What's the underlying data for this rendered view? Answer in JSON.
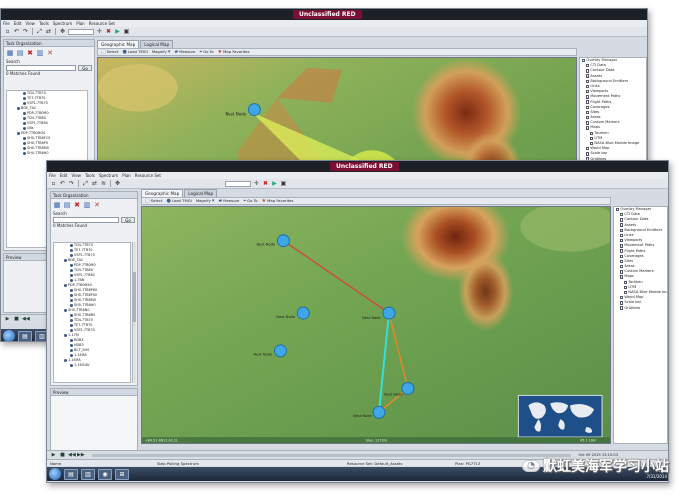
{
  "classification_label": "Unclassified RED",
  "menu": [
    "File",
    "Edit",
    "View",
    "Tools",
    "Spectrum",
    "Plan",
    "Resource Set"
  ],
  "org_panel": {
    "title": "Task Organization",
    "search_label": "Search",
    "go_label": "Go",
    "matches_label": "0 Matches Found"
  },
  "back_tree": [
    "TCN-7TB70",
    "TE7-7TB70",
    "VSP1-7TB70",
    "BDE_TAC",
    "PDP-7TB0M0",
    "TCN-7TB80",
    "VSP1-7TB80",
    "UBs",
    "PDP-7TB0MG0",
    "SH0-7TB6FC0",
    "SH0-7TB6P0",
    "SH0-7TB6M0",
    "SH0-7TB6H0"
  ],
  "front_tree": [
    "TCN-7TB70",
    "TE7-7TB70",
    "VSP1-7TB70",
    "BDE_TAC",
    "PDP-7TB0M0",
    "TCN-7TB80",
    "VSP1-7TB80",
    "1-7BN",
    "PDP-7TB0M40",
    "SH0-7TB6P60",
    "SH0-7TB6P40",
    "SH0-7TB6M0",
    "SH0-7TB6H0",
    "SH0-7TB6N0",
    "SH0-7TB6R0",
    "TCN-7TB70",
    "TE7-7TB70",
    "VSP1-7TB70",
    "1-17M",
    "RDB3",
    "HDB3",
    "BCT_SHS",
    "1-16IFA",
    "1-16IFA",
    "1-16ICAV"
  ],
  "map_tabs": [
    "Geographic Map",
    "Logical Map"
  ],
  "map_toolbar": [
    {
      "icon": "select-icon",
      "label": "Select"
    },
    {
      "icon": "load-icon",
      "label": "Load TMGI"
    },
    {
      "icon": "magnify-icon",
      "label": "Magnify"
    },
    {
      "icon": "measure-icon",
      "label": "Measure"
    },
    {
      "icon": "goto-icon",
      "label": "Go To"
    },
    {
      "icon": "star-icon",
      "label": "Map Favorites"
    }
  ],
  "overlay_manager": [
    {
      "label": "Overlay Manager",
      "checked": true
    },
    {
      "label": "CTI Data",
      "checked": true
    },
    {
      "label": "Contour Data",
      "checked": false
    },
    {
      "label": "Assets",
      "checked": true
    },
    {
      "label": "Background Emitters",
      "checked": false
    },
    {
      "label": "Links",
      "checked": true
    },
    {
      "label": "Viewports",
      "checked": false
    },
    {
      "label": "Movement Paths",
      "checked": true
    },
    {
      "label": "Flight Paths",
      "checked": false
    },
    {
      "label": "Coverages",
      "checked": true
    },
    {
      "label": "Sites",
      "checked": false
    },
    {
      "label": "Areas",
      "checked": true
    },
    {
      "label": "Custom Markers",
      "checked": false
    },
    {
      "label": "Maps",
      "checked": true
    },
    {
      "label": "Tauthen",
      "checked": true
    },
    {
      "label": "UTM",
      "checked": false
    },
    {
      "label": "NASA Blue Marble Image",
      "checked": true
    },
    {
      "label": "World Map",
      "checked": true
    },
    {
      "label": "Scale bar",
      "checked": false
    },
    {
      "label": "Gridlines",
      "checked": false
    }
  ],
  "preview_label": "Preview",
  "front_status": {
    "left": "Name",
    "middle": "Step Polling Spectrum",
    "resource": "Resource Set: Default_Assets",
    "plan": "Plan: PG7T13"
  },
  "front_map_status_left": "+84.31 4N11.42.1L",
  "front_map_status_mid": "Elev. 1173m",
  "front_map_status_right": "45.1 16m",
  "node_labels": [
    "Nest Node",
    "Nest Node",
    "Nest Node",
    "Nest Node",
    "Nest Node",
    "Nest Node",
    "Nest Node"
  ],
  "date_readout": "Oct 09 2019 13:15:03",
  "tray_time": "20:30",
  "tray_date": "7/31/2014",
  "watermark_text": "默虹美海军学习小站",
  "colors": {
    "classification": "#7a0f34",
    "link_red": "#c9503a",
    "link_cyan": "#34e0d8",
    "link_orange": "#e08a2a",
    "node": "#3fa7e8",
    "coverage": "#cfe84a"
  }
}
